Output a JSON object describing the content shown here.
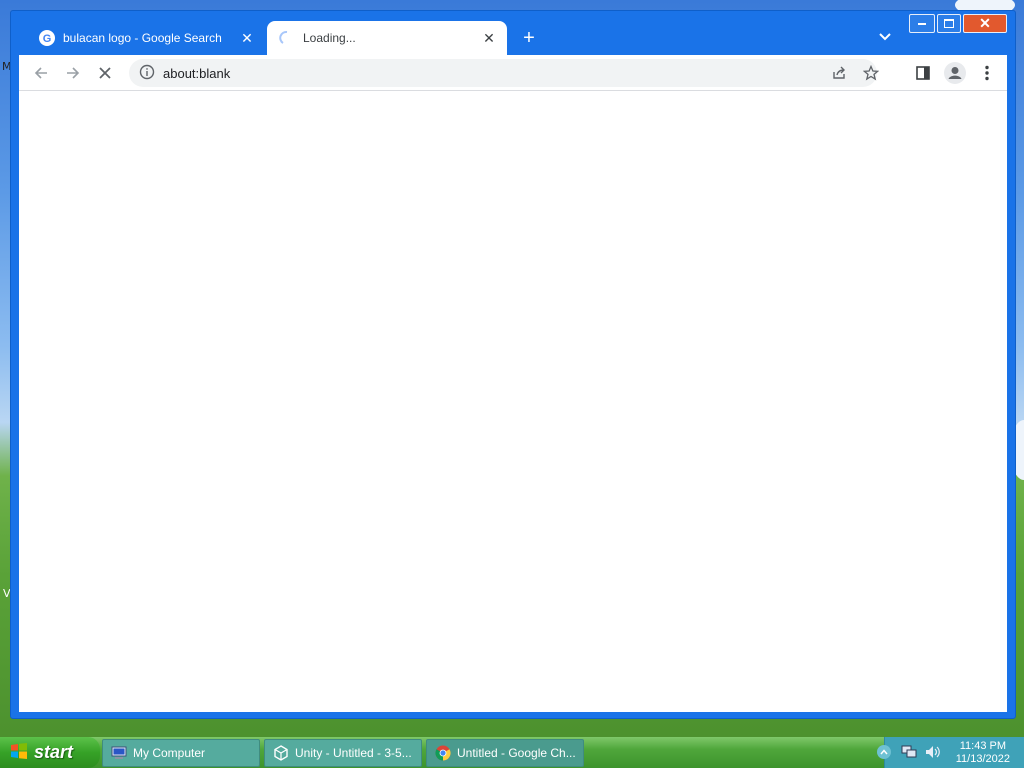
{
  "desktop": {
    "left_fragment_1": "M",
    "left_fragment_2": "V"
  },
  "browser": {
    "tabs": [
      {
        "title": "bulacan logo - Google Search",
        "favicon": "google-g-icon",
        "active": false
      },
      {
        "title": "Loading...",
        "favicon": "loading-spinner-icon",
        "active": true
      }
    ],
    "omnibox": {
      "url": "about:blank"
    },
    "colors": {
      "frame": "#1a73e8",
      "close": "#e2592e"
    }
  },
  "taskbar": {
    "start_label": "start",
    "items": [
      {
        "label": "My Computer",
        "icon": "computer-icon"
      },
      {
        "label": "Unity - Untitled - 3-5...",
        "icon": "unity-icon"
      },
      {
        "label": "Untitled - Google Ch...",
        "icon": "chrome-icon"
      }
    ],
    "clock": {
      "time": "11:43 PM",
      "date": "11/13/2022"
    }
  }
}
